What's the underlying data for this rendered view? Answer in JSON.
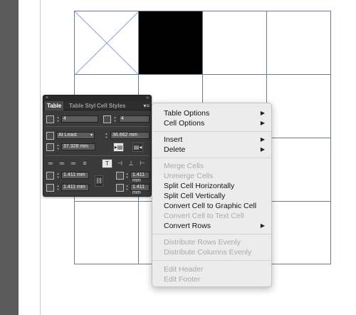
{
  "panel": {
    "tabs": [
      "Table",
      "Table Styles",
      "Cell Styles"
    ],
    "body_rows_value": "4",
    "columns_value": "4",
    "row_height_mode": "At Least",
    "row_height_value": "36.662 mm",
    "column_width_value": "37.328 mm",
    "inset_top": "1.411 mm",
    "inset_bottom": "1.411 mm",
    "inset_left": "1.411 mm",
    "inset_right": "1.411 mm"
  },
  "menu": {
    "table_options": "Table Options",
    "cell_options": "Cell Options",
    "insert": "Insert",
    "delete": "Delete",
    "merge_cells": "Merge Cells",
    "unmerge_cells": "Unmerge Cells",
    "split_horizontally": "Split Cell Horizontally",
    "split_vertically": "Split Cell Vertically",
    "convert_to_graphic": "Convert Cell to Graphic Cell",
    "convert_to_text": "Convert Cell to Text Cell",
    "convert_rows": "Convert Rows",
    "distribute_rows": "Distribute Rows Evenly",
    "distribute_columns": "Distribute Columns Evenly",
    "edit_header": "Edit Header",
    "edit_footer": "Edit Footer"
  },
  "colors": {
    "selected_cell": "#000000",
    "grid_line": "#6b7c8a",
    "frame_cross": "#8fa3d9",
    "panel_bg": "#3a3a3a",
    "menu_bg": "#ececec",
    "disabled_text": "#a9a9a9"
  }
}
